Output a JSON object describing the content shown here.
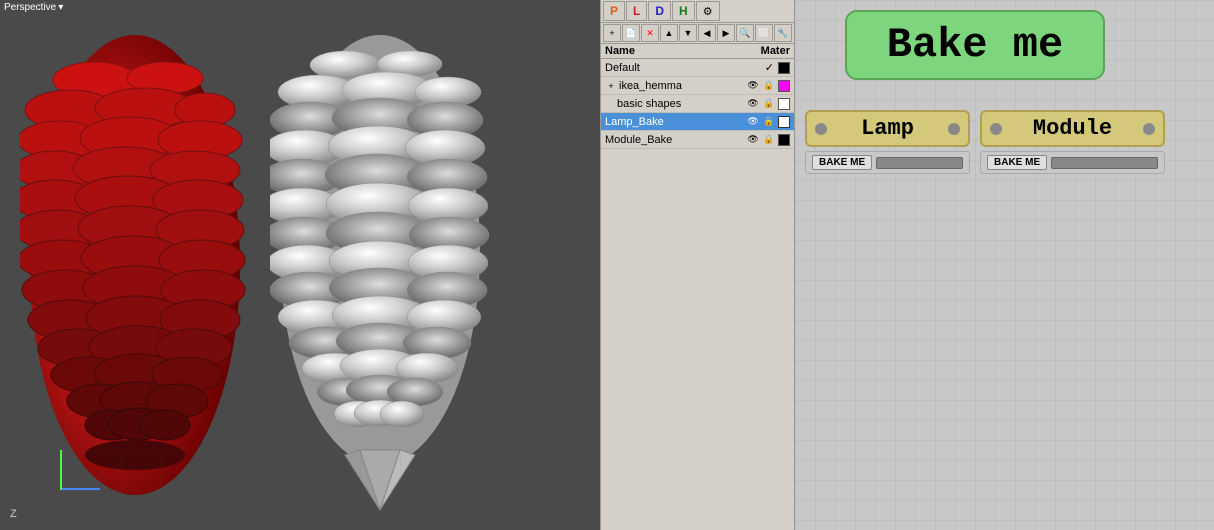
{
  "viewport": {
    "label": "Perspective",
    "dropdown_icon": "▾",
    "z_axis": "Z"
  },
  "scene_panel": {
    "tabs": [
      {
        "label": "P",
        "icon": "🅿",
        "active": false
      },
      {
        "label": "L",
        "icon": "L",
        "active": false
      },
      {
        "label": "D",
        "icon": "D",
        "active": false
      },
      {
        "label": "H",
        "icon": "H",
        "active": false
      },
      {
        "label": "gear",
        "icon": "⚙",
        "active": false
      }
    ],
    "toolbar_icons": [
      "+",
      "📄",
      "✕",
      "▲",
      "▼",
      "◀",
      "▶",
      "🔍",
      "⬜",
      "🔧"
    ],
    "col_name": "Name",
    "col_mater": "Mater",
    "layers": [
      {
        "name": "Default",
        "checkmark": "✓",
        "eye": true,
        "lock": false,
        "color": "#000000",
        "selected": false,
        "is_default": true,
        "expanded": false
      },
      {
        "name": "ikea_hemma",
        "checkmark": "",
        "eye": true,
        "lock": true,
        "color": "#ff00ff",
        "selected": false,
        "is_default": false,
        "expanded": true,
        "expand_icon": "+"
      },
      {
        "name": "basic shapes",
        "checkmark": "",
        "eye": true,
        "lock": true,
        "color": "#ffffff",
        "selected": false,
        "is_default": false,
        "expanded": false
      },
      {
        "name": "Lamp_Bake",
        "checkmark": "",
        "eye": true,
        "lock": true,
        "color": "#ffffff",
        "selected": true,
        "is_default": false,
        "expanded": false
      },
      {
        "name": "Module_Bake",
        "checkmark": "",
        "eye": true,
        "lock": true,
        "color": "#000000",
        "selected": false,
        "is_default": false,
        "expanded": false
      }
    ]
  },
  "node_panel": {
    "bake_me_label": "Bake me",
    "nodes": [
      {
        "id": "lamp",
        "title": "Lamp",
        "bake_label": "BAKE ME"
      },
      {
        "id": "module",
        "title": "Module",
        "bake_label": "BAKE ME"
      }
    ]
  }
}
